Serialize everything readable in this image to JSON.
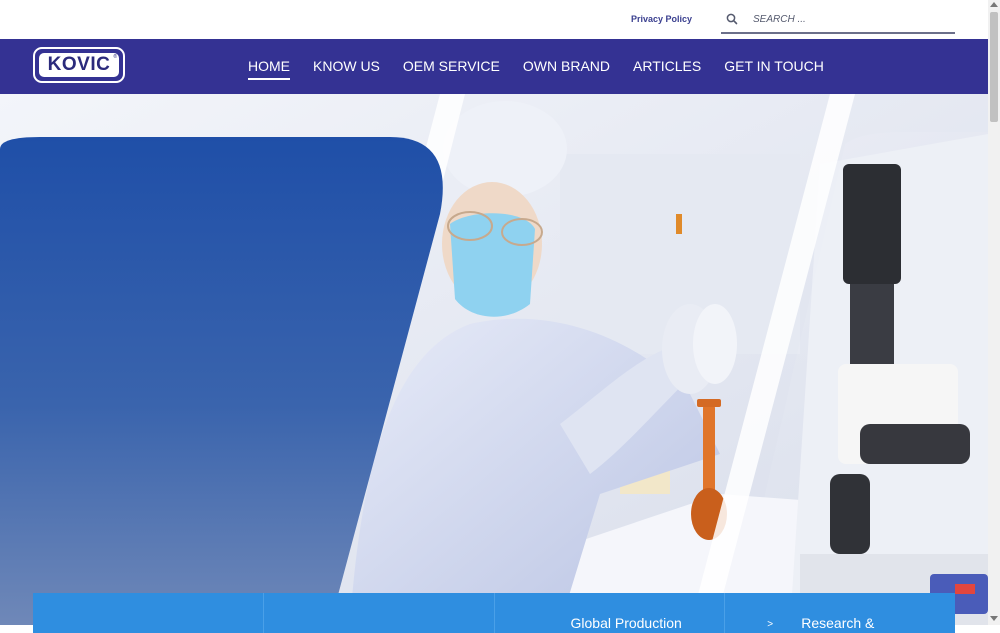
{
  "topbar": {
    "privacy_label": "Privacy Policy",
    "search_placeholder": "SEARCH ...",
    "search_value": "",
    "search_icon": "search-icon"
  },
  "brand": {
    "logo_text": "KOVIC",
    "logo_mark": "®"
  },
  "nav": {
    "items": [
      {
        "label": "HOME",
        "active": true
      },
      {
        "label": "KNOW US",
        "active": false
      },
      {
        "label": "OEM SERVICE",
        "active": false
      },
      {
        "label": "OWN BRAND",
        "active": false
      },
      {
        "label": "ARTICLES",
        "active": false
      },
      {
        "label": "GET IN TOUCH",
        "active": false
      }
    ]
  },
  "features": {
    "items": [
      {
        "label": ""
      },
      {
        "label": ""
      },
      {
        "label": "Global Production"
      },
      {
        "label": "Research &",
        "arrow": ">"
      }
    ]
  },
  "colors": {
    "nav_bg": "#343293",
    "strip_bg": "#2f8ee0",
    "hero_panel": "#2a55a8"
  }
}
